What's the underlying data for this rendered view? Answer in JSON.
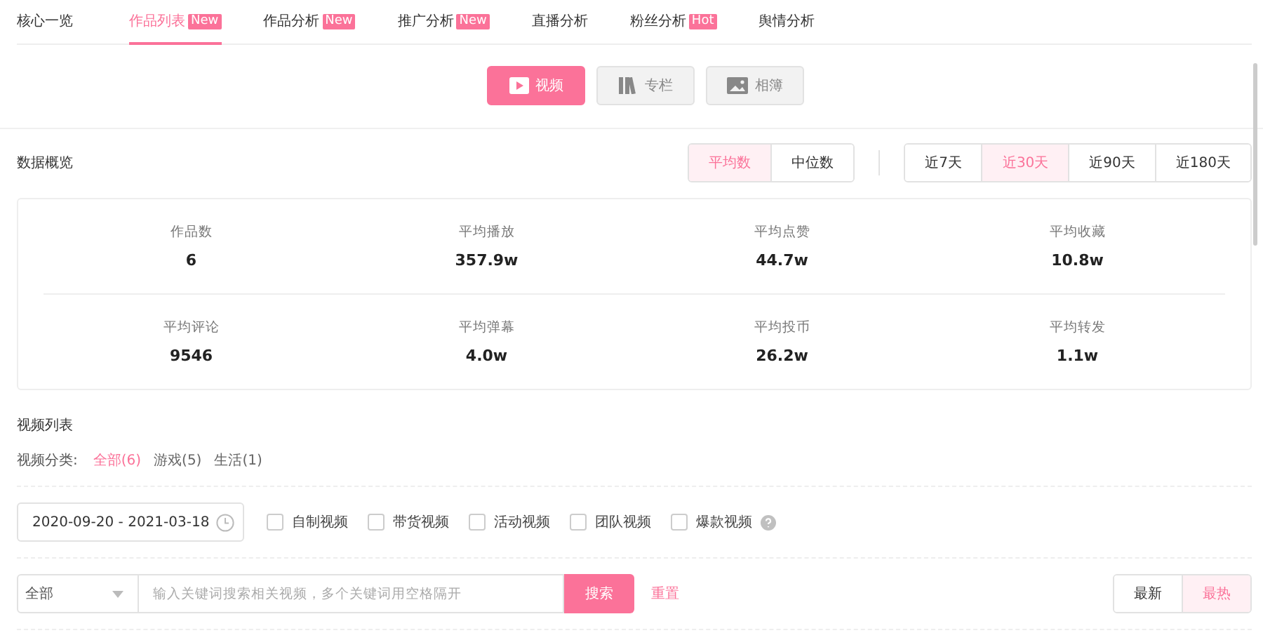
{
  "tabs": [
    {
      "label": "核心一览",
      "selected": false
    },
    {
      "label": "作品列表",
      "badge": "New",
      "selected": true
    },
    {
      "label": "作品分析",
      "badge": "New",
      "selected": false
    },
    {
      "label": "推广分析",
      "badge": "New",
      "selected": false
    },
    {
      "label": "直播分析",
      "selected": false
    },
    {
      "label": "粉丝分析",
      "badge": "Hot",
      "selected": false
    },
    {
      "label": "舆情分析",
      "selected": false
    }
  ],
  "content_types": [
    {
      "label": "视频",
      "kind": "video",
      "selected": true
    },
    {
      "label": "专栏",
      "kind": "column",
      "selected": false
    },
    {
      "label": "相簿",
      "kind": "album",
      "selected": false
    }
  ],
  "overview": {
    "title": "数据概览",
    "stat_modes": [
      {
        "label": "平均数",
        "selected": true
      },
      {
        "label": "中位数",
        "selected": false
      }
    ],
    "ranges": [
      {
        "label": "近7天",
        "selected": false
      },
      {
        "label": "近30天",
        "selected": true
      },
      {
        "label": "近90天",
        "selected": false
      },
      {
        "label": "近180天",
        "selected": false
      }
    ],
    "stats": [
      [
        {
          "label": "作品数",
          "value": "6"
        },
        {
          "label": "平均播放",
          "value": "357.9w"
        },
        {
          "label": "平均点赞",
          "value": "44.7w"
        },
        {
          "label": "平均收藏",
          "value": "10.8w"
        }
      ],
      [
        {
          "label": "平均评论",
          "value": "9546"
        },
        {
          "label": "平均弹幕",
          "value": "4.0w"
        },
        {
          "label": "平均投币",
          "value": "26.2w"
        },
        {
          "label": "平均转发",
          "value": "1.1w"
        }
      ]
    ]
  },
  "video_list": {
    "title": "视频列表",
    "category_label": "视频分类:",
    "categories": [
      {
        "label": "全部(6)",
        "selected": true
      },
      {
        "label": "游戏(5)",
        "selected": false
      },
      {
        "label": "生活(1)",
        "selected": false
      }
    ],
    "date_range": "2020-09-20 - 2021-03-18",
    "filters": [
      {
        "label": "自制视频",
        "checked": false,
        "help": false
      },
      {
        "label": "带货视频",
        "checked": false,
        "help": false
      },
      {
        "label": "活动视频",
        "checked": false,
        "help": false
      },
      {
        "label": "团队视频",
        "checked": false,
        "help": false
      },
      {
        "label": "爆款视频",
        "checked": false,
        "help": true
      }
    ],
    "scope": "全部",
    "search_placeholder": "输入关键词搜索相关视频，多个关键词用空格隔开",
    "search_button": "搜索",
    "reset": "重置",
    "sort": [
      {
        "label": "最新",
        "selected": false
      },
      {
        "label": "最热",
        "selected": true
      }
    ]
  }
}
